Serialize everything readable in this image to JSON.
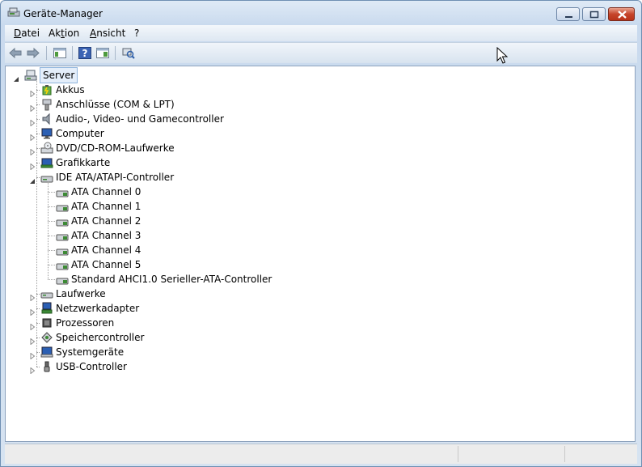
{
  "window": {
    "title": "Geräte-Manager"
  },
  "menu": [
    {
      "label": "Datei",
      "name": "menu-datei"
    },
    {
      "label": "Aktion",
      "name": "menu-aktion"
    },
    {
      "label": "Ansicht",
      "name": "menu-ansicht"
    },
    {
      "label": "?",
      "name": "menu-help"
    }
  ],
  "toolbar": {
    "buttons": [
      "back-arrow-icon",
      "forward-arrow-icon",
      "show-hide-console-tree-icon",
      "help-icon",
      "properties-icon",
      "scan-hardware-icon"
    ]
  },
  "tree": {
    "root": {
      "label": "Server",
      "icon": "computer-icon"
    },
    "categories": [
      {
        "label": "Akkus",
        "icon": "battery-icon",
        "expanded": false
      },
      {
        "label": "Anschlüsse (COM & LPT)",
        "icon": "port-icon",
        "expanded": false
      },
      {
        "label": "Audio-, Video- und Gamecontroller",
        "icon": "speaker-icon",
        "expanded": false
      },
      {
        "label": "Computer",
        "icon": "monitor-icon",
        "expanded": false
      },
      {
        "label": "DVD/CD-ROM-Laufwerke",
        "icon": "optical-drive-icon",
        "expanded": false
      },
      {
        "label": "Grafikkarte",
        "icon": "display-adapter-icon",
        "expanded": false
      },
      {
        "label": "IDE ATA/ATAPI-Controller",
        "icon": "ide-controller-icon",
        "expanded": true,
        "children": [
          "ATA Channel 0",
          "ATA Channel 1",
          "ATA Channel 2",
          "ATA Channel 3",
          "ATA Channel 4",
          "ATA Channel 5",
          "Standard AHCI1.0 Serieller-ATA-Controller"
        ]
      },
      {
        "label": "Laufwerke",
        "icon": "disk-drive-icon",
        "expanded": false
      },
      {
        "label": "Netzwerkadapter",
        "icon": "network-adapter-icon",
        "expanded": false
      },
      {
        "label": "Prozessoren",
        "icon": "processor-icon",
        "expanded": false
      },
      {
        "label": "Speichercontroller",
        "icon": "storage-controller-icon",
        "expanded": false
      },
      {
        "label": "Systemgeräte",
        "icon": "system-devices-icon",
        "expanded": false
      },
      {
        "label": "USB-Controller",
        "icon": "usb-icon",
        "expanded": false
      }
    ]
  },
  "status": {
    "cells": [
      "",
      "",
      ""
    ]
  }
}
